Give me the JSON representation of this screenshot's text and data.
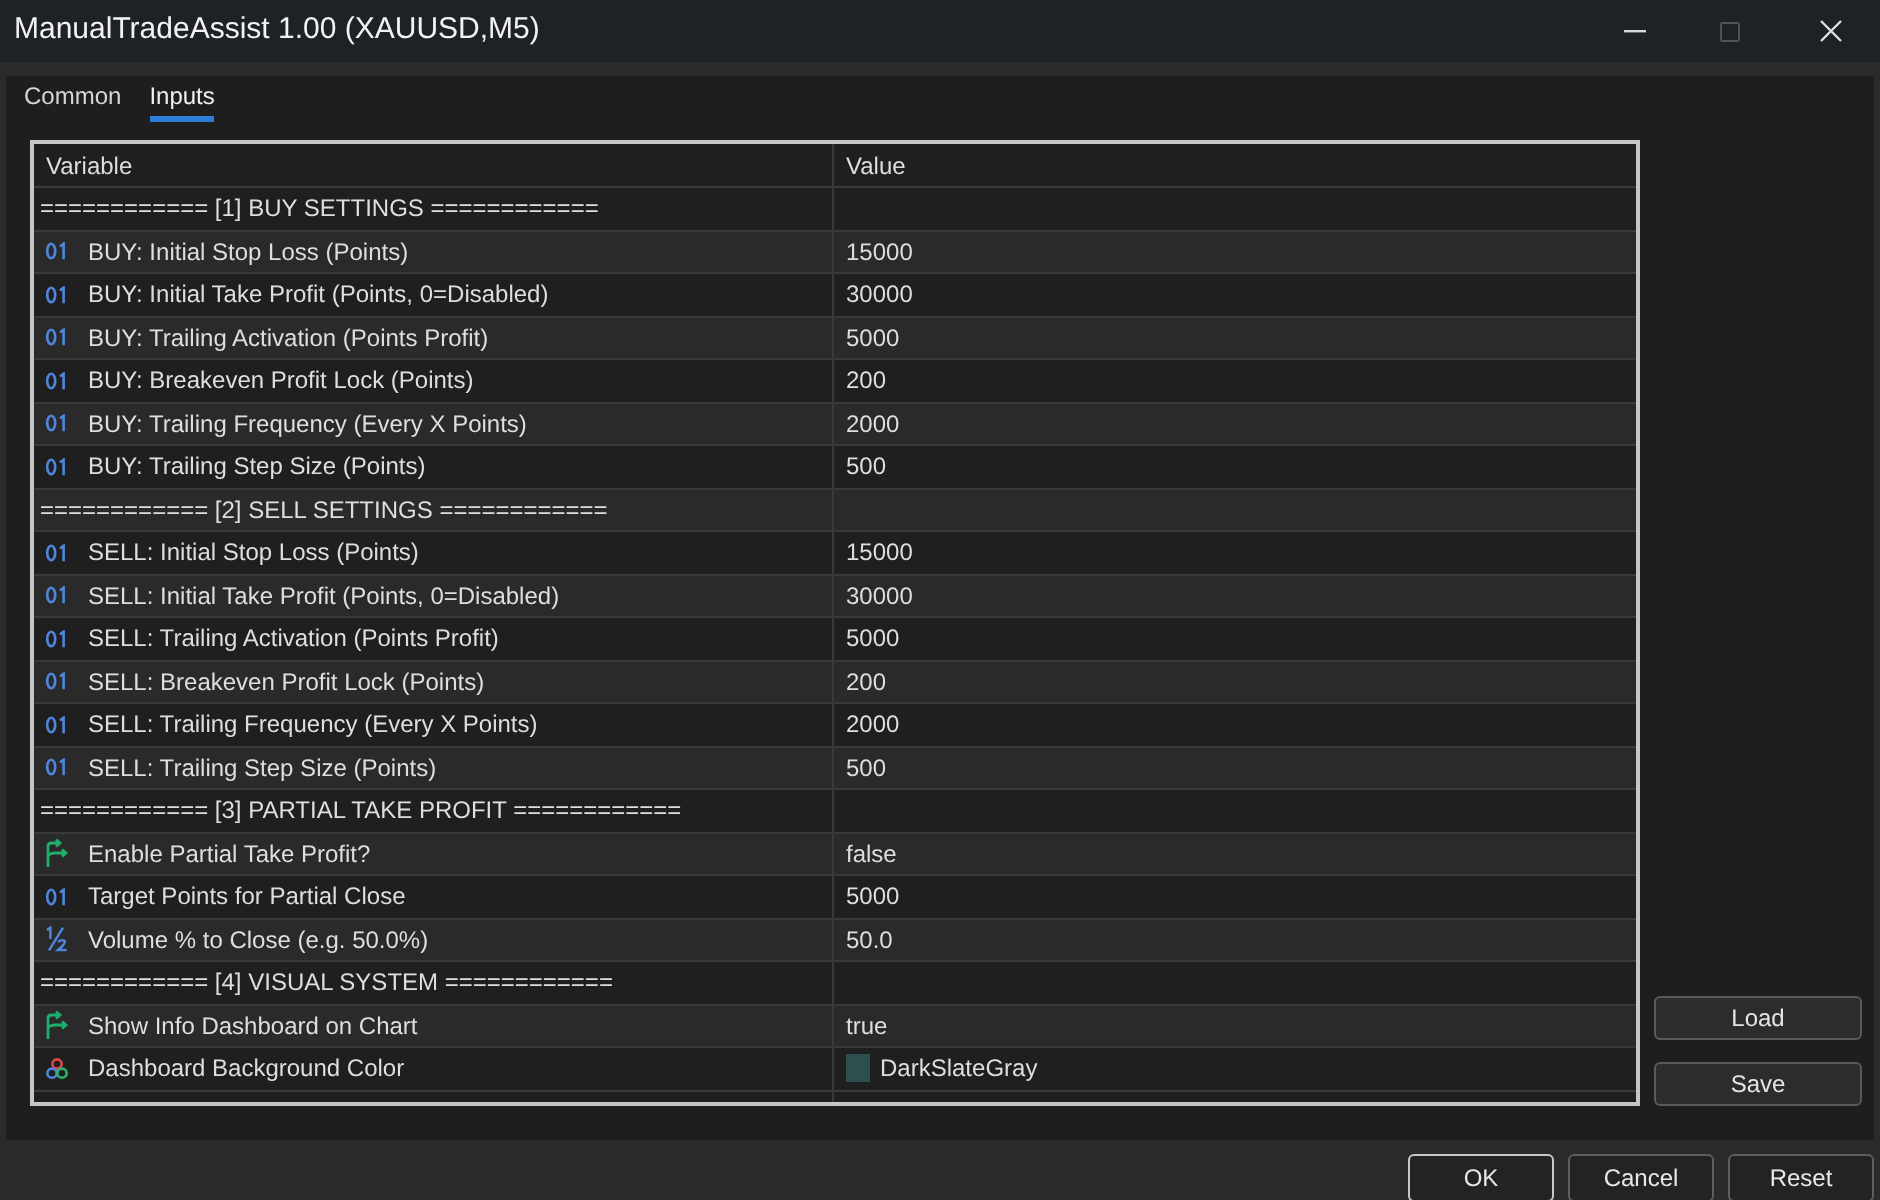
{
  "window": {
    "title": "ManualTradeAssist 1.00 (XAUUSD,M5)",
    "maximize_disabled": true
  },
  "tabs": [
    {
      "label": "Common",
      "selected": false
    },
    {
      "label": "Inputs",
      "selected": true
    }
  ],
  "table": {
    "columns": [
      "Variable",
      "Value"
    ],
    "rows": [
      {
        "kind": "group",
        "variable": "============ [1] BUY SETTINGS ============"
      },
      {
        "kind": "int",
        "variable": "BUY: Initial Stop Loss (Points)",
        "value": "15000"
      },
      {
        "kind": "int",
        "variable": "BUY: Initial Take Profit (Points, 0=Disabled)",
        "value": "30000"
      },
      {
        "kind": "int",
        "variable": "BUY: Trailing Activation (Points Profit)",
        "value": "5000"
      },
      {
        "kind": "int",
        "variable": "BUY: Breakeven Profit Lock (Points)",
        "value": "200"
      },
      {
        "kind": "int",
        "variable": "BUY: Trailing Frequency (Every X Points)",
        "value": "2000"
      },
      {
        "kind": "int",
        "variable": "BUY: Trailing Step Size (Points)",
        "value": "500"
      },
      {
        "kind": "group",
        "variable": "============ [2] SELL SETTINGS ============"
      },
      {
        "kind": "int",
        "variable": "SELL: Initial Stop Loss (Points)",
        "value": "15000"
      },
      {
        "kind": "int",
        "variable": "SELL: Initial Take Profit (Points, 0=Disabled)",
        "value": "30000"
      },
      {
        "kind": "int",
        "variable": "SELL: Trailing Activation (Points Profit)",
        "value": "5000"
      },
      {
        "kind": "int",
        "variable": "SELL: Breakeven Profit Lock (Points)",
        "value": "200"
      },
      {
        "kind": "int",
        "variable": "SELL: Trailing Frequency (Every X Points)",
        "value": "2000"
      },
      {
        "kind": "int",
        "variable": "SELL: Trailing Step Size (Points)",
        "value": "500"
      },
      {
        "kind": "group",
        "variable": "============ [3] PARTIAL TAKE PROFIT ============"
      },
      {
        "kind": "bool",
        "variable": "Enable Partial Take Profit?",
        "value": "false"
      },
      {
        "kind": "int",
        "variable": "Target Points for Partial Close",
        "value": "5000"
      },
      {
        "kind": "double",
        "variable": "Volume % to Close (e.g. 50.0%)",
        "value": "50.0"
      },
      {
        "kind": "group",
        "variable": "============ [4] VISUAL SYSTEM ============"
      },
      {
        "kind": "bool",
        "variable": "Show Info Dashboard on Chart",
        "value": "true"
      },
      {
        "kind": "color",
        "variable": "Dashboard Background Color",
        "value": "DarkSlateGray",
        "color": "#2f4f4f"
      }
    ]
  },
  "side_buttons": [
    "Load",
    "Save"
  ],
  "footer_buttons": [
    {
      "label": "OK",
      "default": true
    },
    {
      "label": "Cancel",
      "default": false
    },
    {
      "label": "Reset",
      "default": false
    }
  ]
}
